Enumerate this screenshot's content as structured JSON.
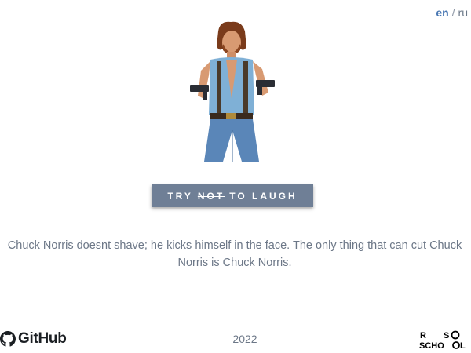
{
  "language": {
    "active": "en",
    "separator": "/",
    "other": "ru"
  },
  "hero": {
    "icon": "chuck-norris-image"
  },
  "button": {
    "part1": "TRY",
    "strike": "NOT",
    "part2": "TO LAUGH"
  },
  "joke": {
    "text": "Chuck Norris doesnt shave; he kicks himself in the face. The only thing that can cut Chuck Norris is Chuck Norris."
  },
  "footer": {
    "github_label": "GitHub",
    "year": "2022",
    "school_logo_text": "RS SCHOOL"
  },
  "colors": {
    "accent": "#4a78b3",
    "button_bg": "#6f7f96",
    "text_muted": "#6c7787"
  }
}
